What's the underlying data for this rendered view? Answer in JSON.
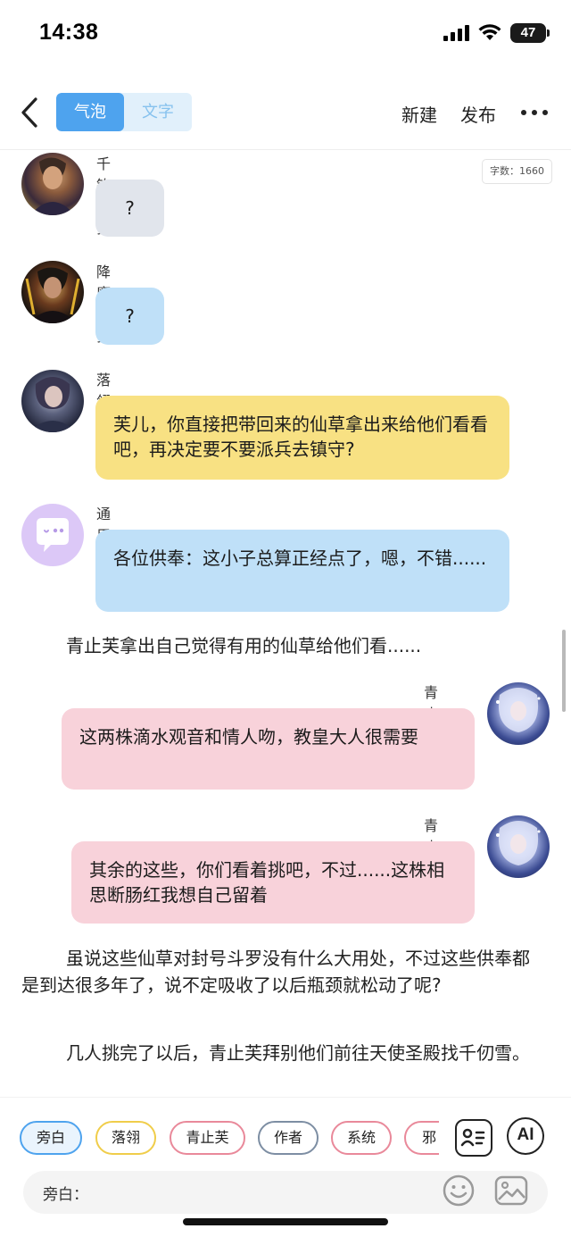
{
  "status_bar": {
    "time": "14:38",
    "battery": "47"
  },
  "nav": {
    "tabs": [
      "气泡",
      "文字"
    ],
    "active_tab": 0,
    "new_label": "新建",
    "publish_label": "发布"
  },
  "word_count": "字数：1660",
  "messages": [
    {
      "name": "千钧斗罗",
      "text": "?"
    },
    {
      "name": "降魔斗罗",
      "text": "?"
    },
    {
      "name": "落翎",
      "text": "芙儿，你直接把带回来的仙草拿出来给他们看看吧，再决定要不要派兵去镇守?"
    },
    {
      "name": "通用",
      "text": "各位供奉：这小子总算正经点了，嗯，不错......"
    },
    {
      "narration": "青止芙拿出自己觉得有用的仙草给他们看......"
    },
    {
      "name": "青止芙",
      "text": "这两株滴水观音和情人吻，教皇大人很需要"
    },
    {
      "name": "青止芙",
      "text": "其余的这些，你们看着挑吧，不过......这株相思断肠红我想自己留着"
    },
    {
      "narration": "虽说这些仙草对封号斗罗没有什么大用处，不过这些供奉都是到达很多年了，说不定吸收了以后瓶颈就松动了呢?"
    },
    {
      "narration": "几人挑完了以后，青止芙拜别他们前往天使圣殿找千仞雪。"
    }
  ],
  "characters": [
    {
      "label": "旁白",
      "color": "#4ea3ee"
    },
    {
      "label": "落翎",
      "color": "#f0cd4a"
    },
    {
      "label": "青止芙",
      "color": "#e9899a"
    },
    {
      "label": "作者",
      "color": "#7d8ea3"
    },
    {
      "label": "系统",
      "color": "#e9899a"
    },
    {
      "label": "邪",
      "color": "#e9899a"
    }
  ],
  "input": {
    "label": "旁白："
  },
  "icons": [
    "back-icon",
    "more-icon",
    "character-card-icon",
    "ai-icon",
    "emoji-icon",
    "image-icon"
  ]
}
